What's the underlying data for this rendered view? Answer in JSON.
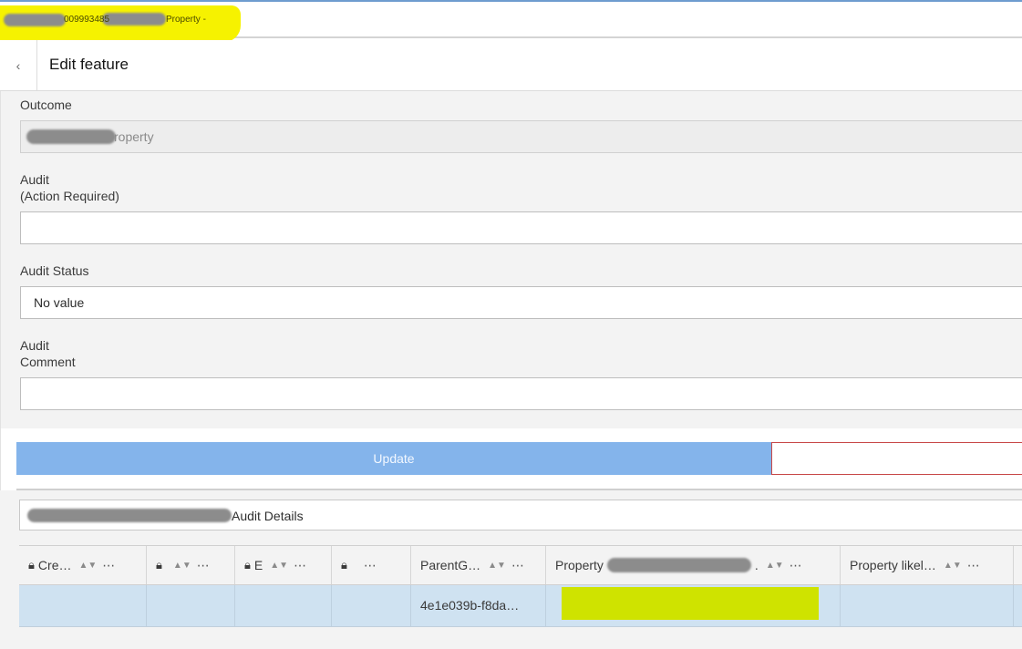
{
  "titlebar": {
    "id_fragment": "009993485",
    "suffix": "Property -",
    "highlight_color": "#f6f200"
  },
  "editor": {
    "title": "Edit feature",
    "back_icon": "chevron-left-icon",
    "fields": [
      {
        "label": "Outcome",
        "value": "roperty"
      },
      {
        "label": "Audit\n(Action Required)",
        "value": ""
      },
      {
        "label": "Audit Status",
        "value": "No value"
      },
      {
        "label": "Audit\nComment",
        "value": ""
      }
    ]
  },
  "actions": {
    "update_label": "Update",
    "update_color": "#84b4eb",
    "cancel_border_color": "#c84848"
  },
  "table": {
    "tab_label": "Audit Details",
    "columns": [
      {
        "label": "Cre…",
        "locked": true
      },
      {
        "label": "",
        "locked": true
      },
      {
        "label": "E",
        "locked": true
      },
      {
        "label": "",
        "locked": true
      },
      {
        "label": "ParentG…",
        "locked": false
      },
      {
        "label": "Property",
        "locked": false
      },
      {
        "label": "Property likel…",
        "locked": false
      }
    ],
    "rows": [
      {
        "cells": [
          "",
          "",
          "",
          "",
          "4e1e039b-f8da…",
          "",
          ""
        ]
      }
    ],
    "row_selected_color": "#cfe2f1",
    "cell_highlight_color": "#cfe300"
  }
}
